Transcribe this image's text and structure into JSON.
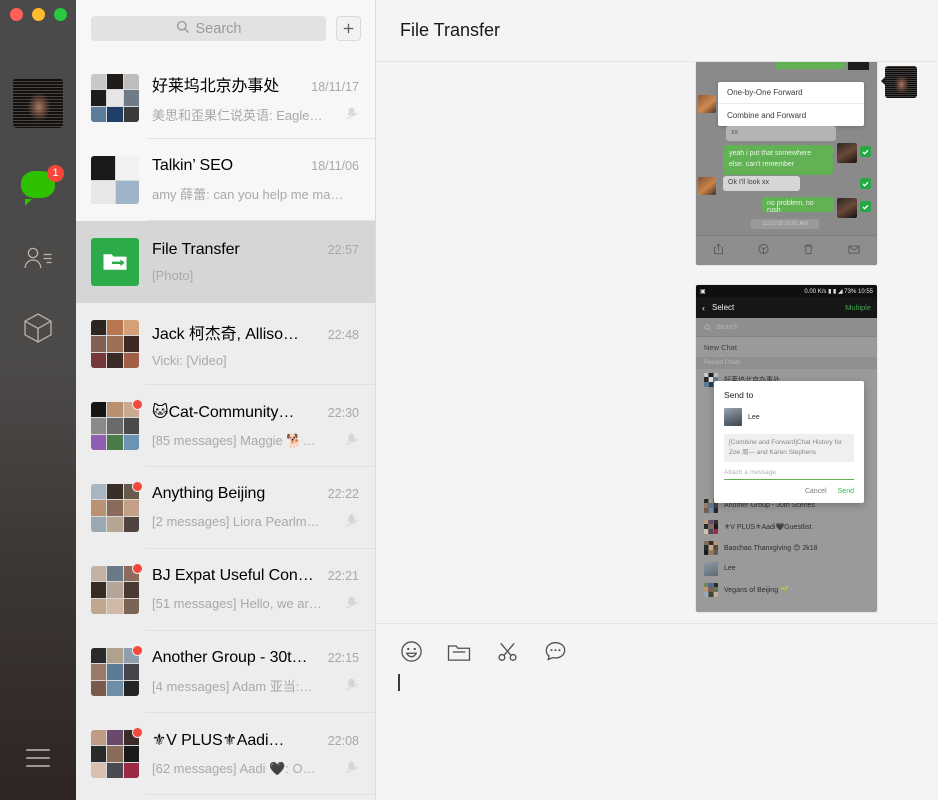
{
  "window": {
    "traffic_lights": [
      "close",
      "minimize",
      "maximize"
    ],
    "colors": {
      "close": "#ff5f57",
      "minimize": "#febc2e",
      "maximize": "#28c840",
      "accent_green": "#2dc100",
      "badge_red": "#f5483a"
    }
  },
  "rail": {
    "avatar_name": "user-avatar",
    "items": [
      {
        "id": "chats",
        "icon": "chat-bubble-icon",
        "badge": "1",
        "active": true
      },
      {
        "id": "contacts",
        "icon": "contacts-icon",
        "badge": "",
        "active": false
      },
      {
        "id": "discover",
        "icon": "cube-icon",
        "badge": "",
        "active": false
      },
      {
        "id": "menu",
        "icon": "hamburger-menu-icon",
        "badge": "",
        "active": false
      }
    ]
  },
  "search": {
    "placeholder": "Search",
    "icon": "search-icon",
    "add_button_label": "+"
  },
  "chat_list": [
    {
      "title": "好莱坞北京办事处",
      "time": "18/11/17",
      "preview": "美思和歪果仁说英语: Eagle…",
      "muted": true,
      "unread": false,
      "selected": false,
      "avatar_type": "grid9",
      "avatar_colors": [
        "#c8c8c8",
        "#221c18",
        "#bdbdbd",
        "#1d1d1d",
        "#e6e6e6",
        "#6f7b86",
        "#5d7c9c",
        "#1f3f66",
        "#3a3a3a"
      ]
    },
    {
      "title": "Talkin’ SEO",
      "time": "18/11/06",
      "preview": "amy 薛蕾: can you help me ma…",
      "muted": false,
      "unread": false,
      "selected": false,
      "avatar_type": "grid4",
      "avatar_colors": [
        "#1a1a1a",
        "#ffffff",
        "#dcdcdc",
        "#9fb4c6"
      ]
    },
    {
      "title": "File Transfer",
      "time": "22:57",
      "preview": "[Photo]",
      "muted": false,
      "unread": false,
      "selected": true,
      "avatar_type": "file-transfer-icon",
      "avatar_colors": []
    },
    {
      "title": "Jack 柯杰奇, Alliso…",
      "time": "22:48",
      "preview": "Vicki: [Video]",
      "muted": false,
      "unread": false,
      "selected": false,
      "avatar_type": "grid9",
      "avatar_colors": [
        "#2c2520",
        "#b8764e",
        "#d4a07a",
        "#846054",
        "#9c7158",
        "#3d2a22",
        "#74383a",
        "#3a2b28",
        "#a35f45"
      ]
    },
    {
      "title": "🐱Cat-Community…",
      "time": "22:30",
      "preview": "[85 messages] Maggie 🐕…",
      "muted": true,
      "unread": true,
      "selected": false,
      "avatar_type": "grid9",
      "avatar_colors": [
        "#151515",
        "#b8906f",
        "#c9a98f",
        "#8a8a8a",
        "#6a6a6a",
        "#4a4a4a",
        "#8e5fb0",
        "#4c7b4a",
        "#6b93b5"
      ]
    },
    {
      "title": "Anything Beijing",
      "time": "22:22",
      "preview": "[2 messages] Liora Pearlm…",
      "muted": true,
      "unread": true,
      "selected": false,
      "avatar_type": "grid9",
      "avatar_colors": [
        "#a8b6c2",
        "#3a2e28",
        "#6a5a4c",
        "#b99274",
        "#8a6a58",
        "#c4a089",
        "#9aa8b4",
        "#b7a594",
        "#514440"
      ]
    },
    {
      "title": "BJ Expat Useful Con…",
      "time": "22:21",
      "preview": "[51 messages] Hello, we ar…",
      "muted": true,
      "unread": true,
      "selected": false,
      "avatar_type": "grid9",
      "avatar_colors": [
        "#c4b2a4",
        "#6a7a88",
        "#8d6a5a",
        "#3a2a24",
        "#b4a696",
        "#4a3a34",
        "#c0a88e",
        "#d0b9a6",
        "#7a6458"
      ]
    },
    {
      "title": "Another Group - 30t…",
      "time": "22:15",
      "preview": "[4 messages] Adam 亚当:…",
      "muted": true,
      "unread": true,
      "selected": false,
      "avatar_type": "grid9",
      "avatar_colors": [
        "#2a2a2a",
        "#b0a08c",
        "#8ea0ae",
        "#9a7a68",
        "#5a7a96",
        "#46464a",
        "#7a5a4a",
        "#6e8ea8",
        "#242424"
      ]
    },
    {
      "title": "⚜V PLUS⚜Aadi…",
      "time": "22:08",
      "preview": "[62 messages] Aadi 🖤: O…",
      "muted": true,
      "unread": true,
      "selected": false,
      "avatar_type": "grid9",
      "avatar_colors": [
        "#c09c86",
        "#6a4a6a",
        "#3a2a28",
        "#2a2a2a",
        "#8a6a5a",
        "#1a1a1a",
        "#d8c0b0",
        "#4a4a52",
        "#9c2a44"
      ]
    }
  ],
  "conversation": {
    "title": "File Transfer",
    "messages": [
      {
        "type": "image",
        "name": "forward-menu-screenshot"
      },
      {
        "type": "image",
        "name": "send-to-dialog-screenshot"
      }
    ]
  },
  "screenshot_one": {
    "menu_items": [
      "One-by-One Forward",
      "Combine and Forward"
    ],
    "bubbles": [
      {
        "side": "left",
        "text": "xx"
      },
      {
        "side": "right",
        "text": "yeah i put that somewhere else. can't remember"
      },
      {
        "side": "left",
        "text": "Ok I'll look xx"
      },
      {
        "side": "right",
        "text": "no problem, no rush"
      }
    ],
    "timestamp": "11/11/18 12:01 AM",
    "toolbar_icons": [
      "share-icon",
      "favorite-icon",
      "trash-icon",
      "mail-icon"
    ]
  },
  "screenshot_two": {
    "status_bar": {
      "network": "0.00 K/s",
      "battery": "73%",
      "time": "10:55"
    },
    "nav": {
      "back_icon": "chevron-left-icon",
      "title": "Select",
      "action": "Multiple"
    },
    "search_placeholder": "Search",
    "new_chat_label": "New Chat",
    "section_label": "Recent Chats",
    "rows": [
      "好莱坞北京办事处",
      "Another Group - 30th Scenes",
      "⚜V PLUS⚜Aadi🖤Guestlist",
      "Baochao Thanxgiving 😊 2k18",
      "Lee",
      "Vegans of Beijing 🌱"
    ],
    "dialog": {
      "title": "Send to",
      "recipient": "Lee",
      "quote": "[Combine and Forward]Chat History for Zoe 周— and Karen Stephens",
      "input_placeholder": "Attach a message",
      "cancel_label": "Cancel",
      "send_label": "Send"
    }
  },
  "compose": {
    "tools": [
      "emoji-icon",
      "folder-icon",
      "scissors-icon",
      "chat-history-icon"
    ],
    "input_value": ""
  }
}
